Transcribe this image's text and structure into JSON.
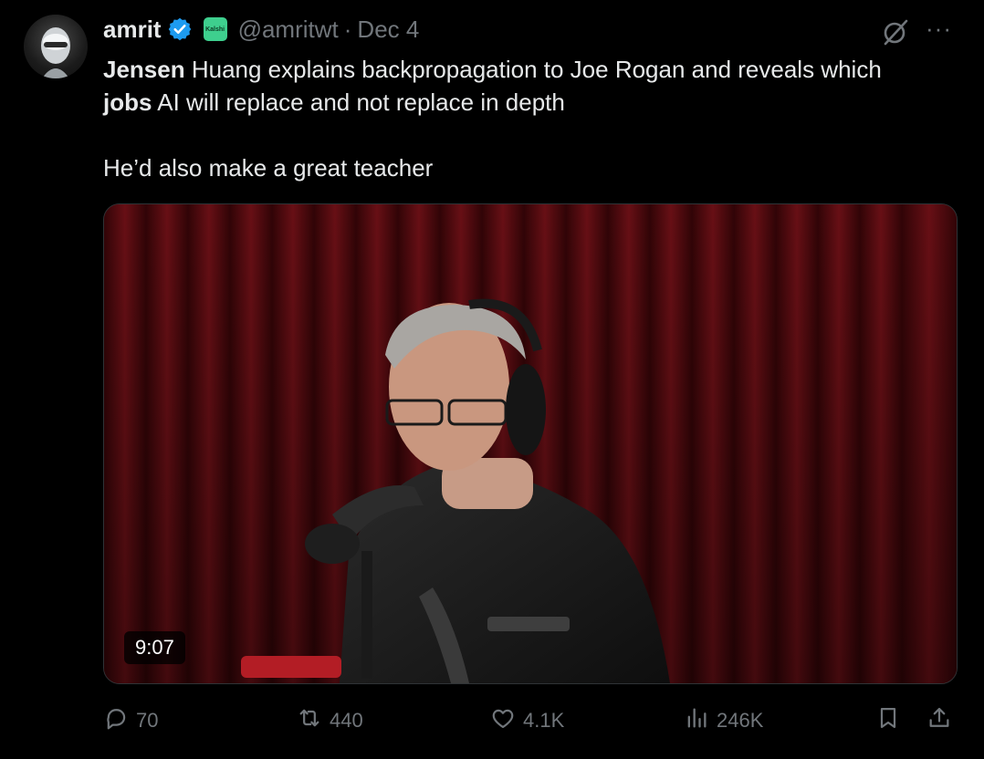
{
  "author": {
    "name": "amrit",
    "affiliate_badge": "Kalshi",
    "handle": "@amritwt",
    "separator": "·",
    "date": "Dec 4"
  },
  "post": {
    "line1_bold": "Jensen",
    "line1_rest": " Huang explains backpropagation to Joe Rogan and reveals which",
    "line2_bold": "jobs",
    "line2_rest": " AI will replace and not replace in depth",
    "line3": "He’d also make a great teacher"
  },
  "video": {
    "duration": "9:07"
  },
  "actions": {
    "replies": "70",
    "reposts": "440",
    "likes": "4.1K",
    "views": "246K"
  },
  "icons": [
    "verified-badge-icon",
    "grok-icon",
    "more-icon",
    "reply-icon",
    "repost-icon",
    "like-icon",
    "views-icon",
    "bookmark-icon",
    "share-icon"
  ],
  "colors": {
    "background": "#000000",
    "text": "#e7e9ea",
    "muted": "#71767b",
    "verified": "#1d9bf0",
    "affiliate": "#3ecf8e"
  }
}
